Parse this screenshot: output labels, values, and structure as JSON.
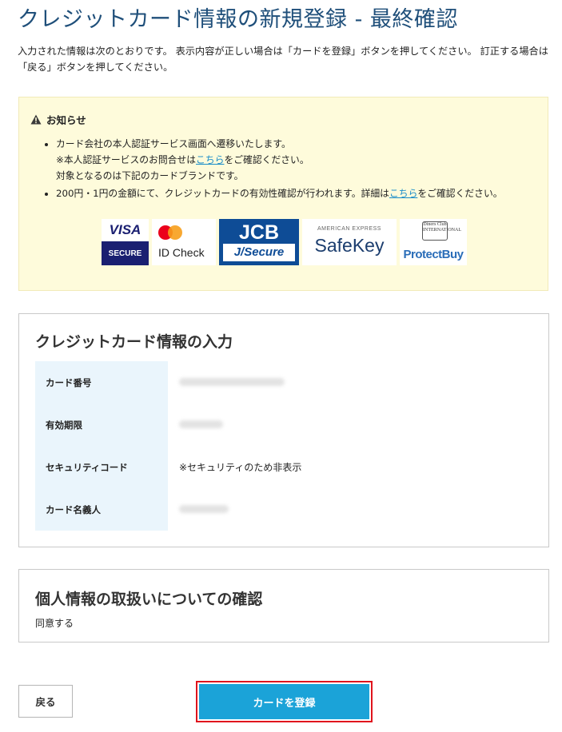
{
  "page": {
    "title": "クレジットカード情報の新規登録 - 最終確認",
    "intro": "入力された情報は次のとおりです。 表示内容が正しい場合は「カードを登録」ボタンを押してください。 訂正する場合は「戻る」ボタンを押してください。"
  },
  "notice": {
    "title": "お知らせ",
    "item1_line1": "カード会社の本人認証サービス画面へ遷移いたします。",
    "item1_line2_prefix": "※本人認証サービスのお問合せは",
    "item1_line2_link": "こちら",
    "item1_line2_suffix": "をご確認ください。",
    "item1_line3": "対象となるのは下記のカードブランドです。",
    "item2_prefix": "200円・1円の金額にて、クレジットカードの有効性確認が行われます。詳細は",
    "item2_link": "こちら",
    "item2_suffix": "をご確認ください。",
    "brands": {
      "visa_top": "VISA",
      "visa_bottom": "SECURE",
      "mastercard": "ID Check",
      "jcb_top": "JCB",
      "jcb_bottom": "J/Secure",
      "amex_small": "AMERICAN EXPRESS",
      "amex_main": "SafeKey",
      "diners_logo": "Diners Club INTERNATIONAL",
      "diners_main": "ProtectBuy"
    }
  },
  "card_panel": {
    "title": "クレジットカード情報の入力",
    "rows": [
      {
        "label": "カード番号",
        "value": ""
      },
      {
        "label": "有効期限",
        "value": ""
      },
      {
        "label": "セキュリティコード",
        "value": "※セキュリティのため非表示"
      },
      {
        "label": "カード名義人",
        "value": ""
      }
    ]
  },
  "privacy_panel": {
    "title": "個人情報の取扱いについての確認",
    "value": "同意する"
  },
  "buttons": {
    "back": "戻る",
    "register": "カードを登録"
  },
  "colors": {
    "title": "#1f4f7a",
    "notice_bg": "#fefbdb",
    "table_header_bg": "#eaf5fc",
    "register_button": "#1ba3d8",
    "highlight_outline": "#e0141d",
    "link": "#1a8dc9"
  },
  "icons": {
    "notice": "warning-triangle-icon"
  }
}
